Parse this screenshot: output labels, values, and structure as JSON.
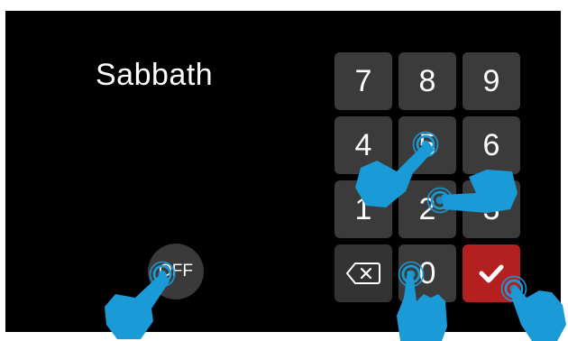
{
  "title": "Sabbath",
  "off_label": "OFF",
  "keypad": {
    "row1": [
      "7",
      "8",
      "9"
    ],
    "row2": [
      "4",
      "5",
      "6"
    ],
    "row3": [
      "1",
      "2",
      "3"
    ],
    "row4_zero": "0",
    "backspace_icon": "backspace-icon",
    "confirm_icon": "checkmark-icon"
  },
  "colors": {
    "background": "#000000",
    "key": "#3b3b3b",
    "confirm": "#b41f1f",
    "gesture_hand": "#1a9ad6"
  }
}
